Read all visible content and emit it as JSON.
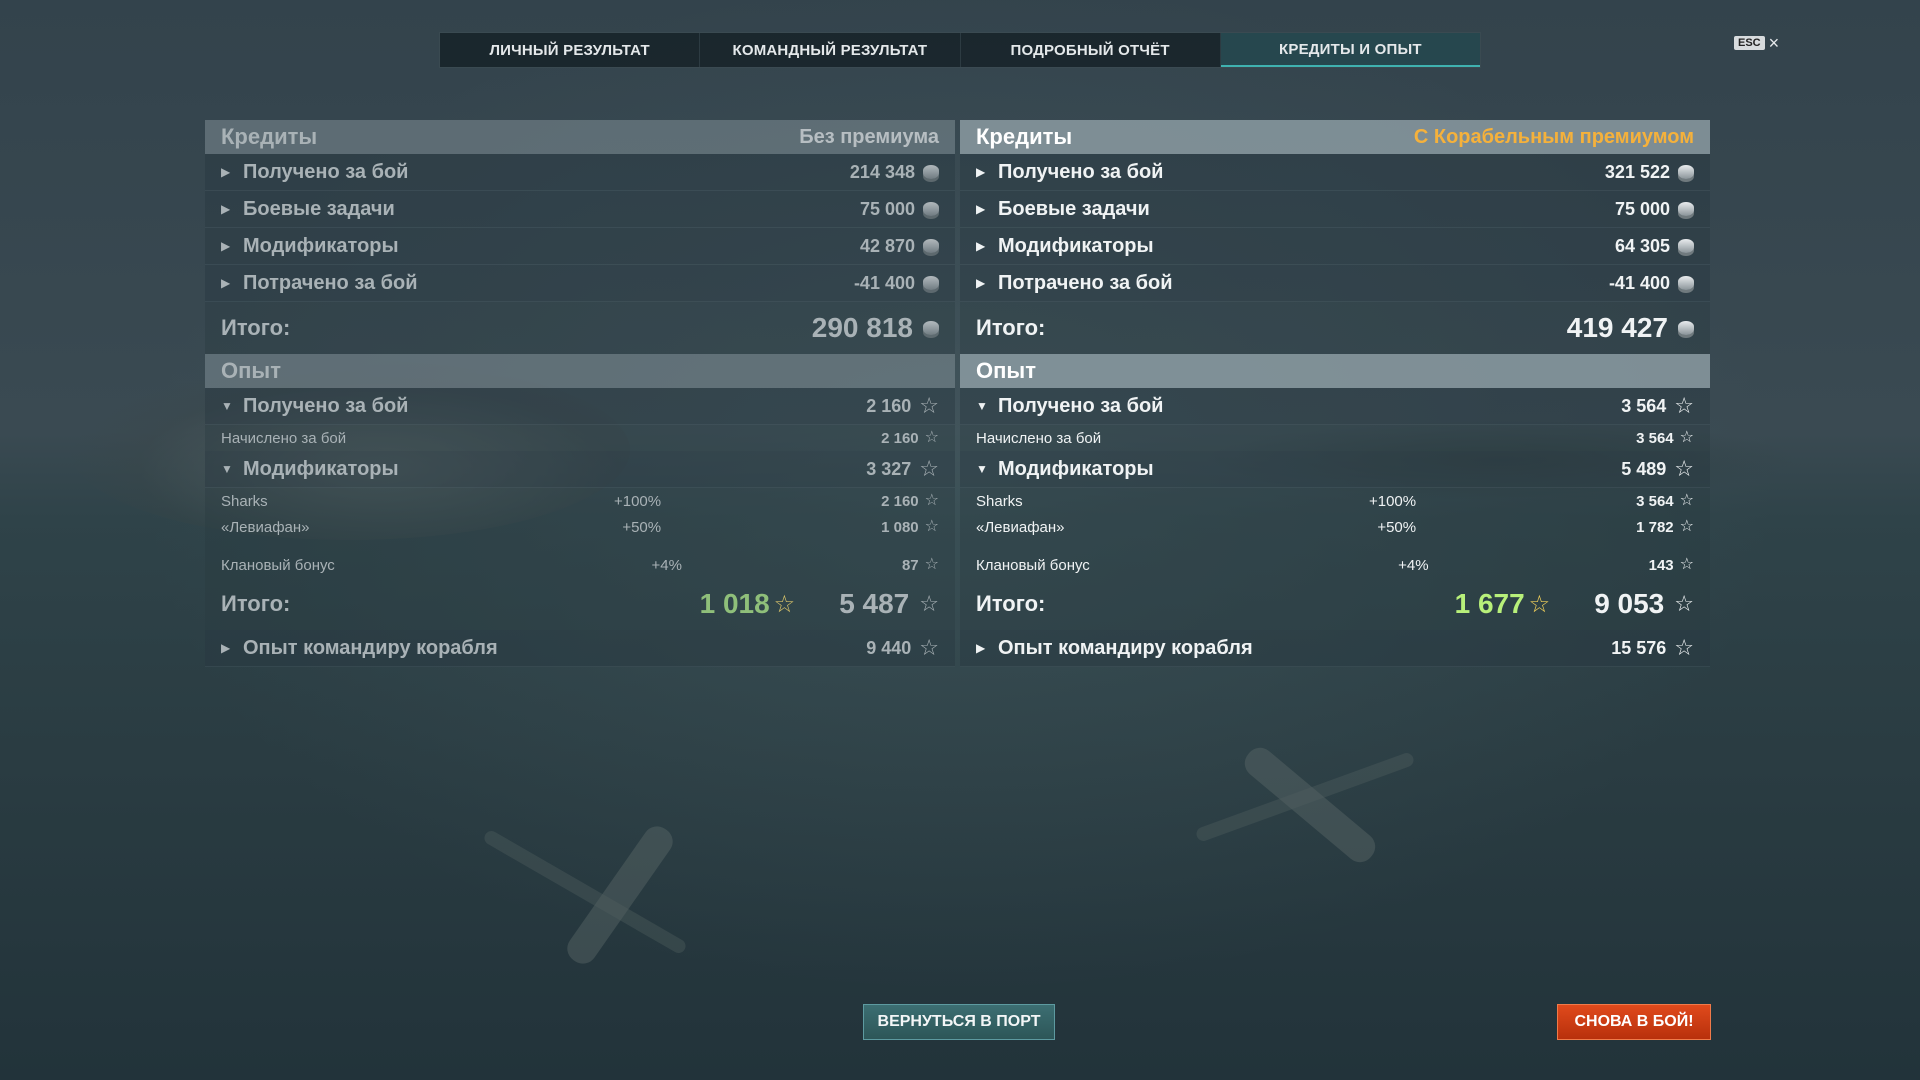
{
  "tabs": [
    {
      "label": "ЛИЧНЫЙ РЕЗУЛЬТАТ"
    },
    {
      "label": "КОМАНДНЫЙ РЕЗУЛЬТАТ"
    },
    {
      "label": "ПОДРОБНЫЙ ОТЧЁТ"
    },
    {
      "label": "КРЕДИТЫ И ОПЫТ"
    }
  ],
  "esc": {
    "key": "ESC",
    "close": "×"
  },
  "left": {
    "credits": {
      "title": "Кредиты",
      "subtitle": "Без премиума",
      "rows": [
        {
          "label": "Получено за бой",
          "value": "214 348"
        },
        {
          "label": "Боевые задачи",
          "value": "75 000"
        },
        {
          "label": "Модификаторы",
          "value": "42 870"
        },
        {
          "label": "Потрачено за бой",
          "value": "-41 400"
        }
      ],
      "total_label": "Итого:",
      "total": "290 818"
    },
    "xp": {
      "title": "Опыт",
      "earned": {
        "label": "Получено за бой",
        "value": "2 160"
      },
      "accrued": {
        "label": "Начислено за бой",
        "value": "2 160"
      },
      "modifiers": {
        "label": "Модификаторы",
        "value": "3 327"
      },
      "mod_rows": [
        {
          "label": "Sharks",
          "pct": "+100%",
          "value": "2 160"
        },
        {
          "label": "«Левиафан»",
          "pct": "+50%",
          "value": "1 080"
        }
      ],
      "clan": {
        "label": "Клановый бонус",
        "pct": "+4%",
        "value": "87"
      },
      "total_label": "Итого:",
      "total_free": "1 018",
      "total": "5 487",
      "commander": {
        "label": "Опыт командиру корабля",
        "value": "9 440"
      }
    }
  },
  "right": {
    "credits": {
      "title": "Кредиты",
      "subtitle": "С Корабельным премиумом",
      "rows": [
        {
          "label": "Получено за бой",
          "value": "321 522"
        },
        {
          "label": "Боевые задачи",
          "value": "75 000"
        },
        {
          "label": "Модификаторы",
          "value": "64 305"
        },
        {
          "label": "Потрачено за бой",
          "value": "-41 400"
        }
      ],
      "total_label": "Итого:",
      "total": "419 427"
    },
    "xp": {
      "title": "Опыт",
      "earned": {
        "label": "Получено за бой",
        "value": "3 564"
      },
      "accrued": {
        "label": "Начислено за бой",
        "value": "3 564"
      },
      "modifiers": {
        "label": "Модификаторы",
        "value": "5 489"
      },
      "mod_rows": [
        {
          "label": "Sharks",
          "pct": "+100%",
          "value": "3 564"
        },
        {
          "label": "«Левиафан»",
          "pct": "+50%",
          "value": "1 782"
        }
      ],
      "clan": {
        "label": "Клановый бонус",
        "pct": "+4%",
        "value": "143"
      },
      "total_label": "Итого:",
      "total_free": "1 677",
      "total": "9 053",
      "commander": {
        "label": "Опыт командиру корабля",
        "value": "15 576"
      }
    }
  },
  "buttons": {
    "port": "ВЕРНУТЬСЯ В ПОРТ",
    "battle": "СНОВА В БОЙ!"
  },
  "colors": {
    "premium_accent": "#f5b13b",
    "free_xp_green": "#b8f07a",
    "battle_button": "#d03d14",
    "port_button": "#2f5a5c"
  }
}
